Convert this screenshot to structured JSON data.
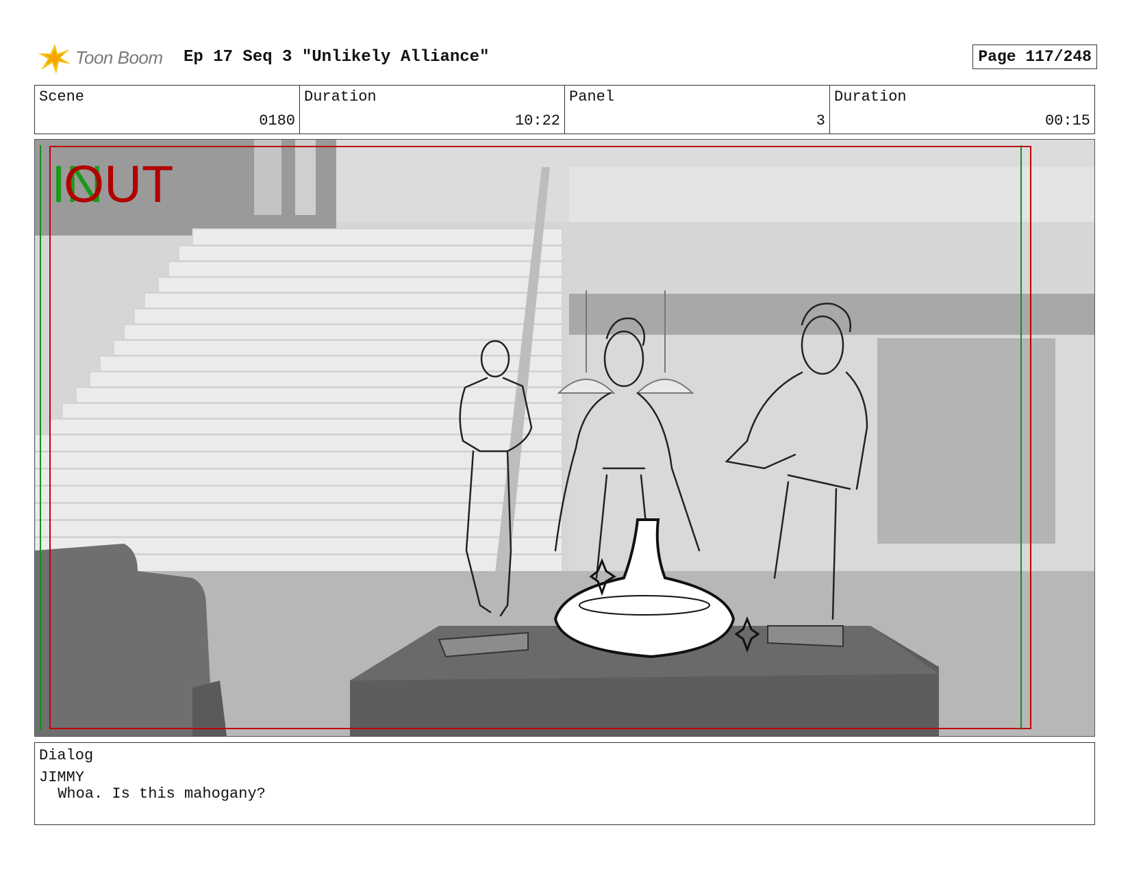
{
  "header": {
    "logo_text": "Toon Boom",
    "title": "Ep 17 Seq 3 \"Unlikely Alliance\"",
    "page": "Page 117/248"
  },
  "info": {
    "scene_label": "Scene",
    "scene_value": "0180",
    "scene_duration_label": "Duration",
    "scene_duration_value": "10:22",
    "panel_label": "Panel",
    "panel_value": "3",
    "panel_duration_label": "Duration",
    "panel_duration_value": "00:15"
  },
  "panel_overlay": {
    "in_label": "IN",
    "out_label": "OUT",
    "in_color": "#1a9a1a",
    "out_color": "#b00000"
  },
  "dialog": {
    "label": "Dialog",
    "speaker": "JIMMY",
    "line": " Whoa. Is this mahogany?"
  }
}
